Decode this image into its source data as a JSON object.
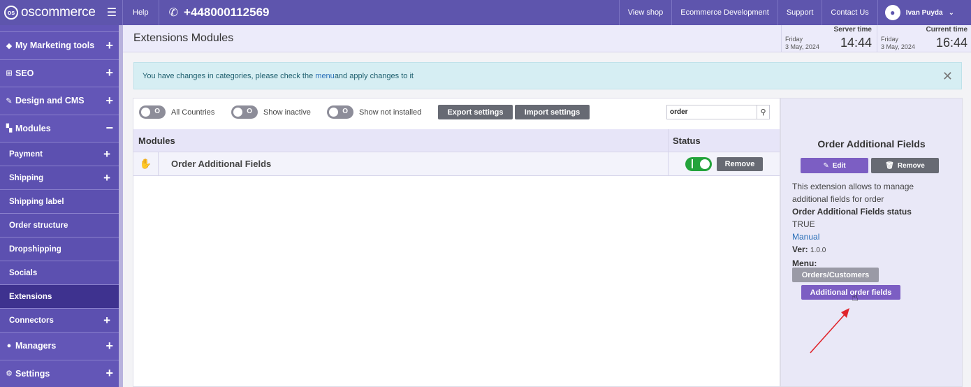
{
  "topbar": {
    "logo_text": "oscommerce",
    "help": "Help",
    "phone": "+448000112569",
    "links": [
      "View shop",
      "Ecommerce Development",
      "Support",
      "Contact Us"
    ],
    "user": "Ivan Puyda"
  },
  "sidebar": {
    "items": [
      {
        "label": "My Marketing tools",
        "icon": "tag-icon",
        "expand": "+"
      },
      {
        "label": "SEO",
        "icon": "sitemap-icon",
        "expand": "+"
      },
      {
        "label": "Design and CMS",
        "icon": "brush-icon",
        "expand": "+"
      },
      {
        "label": "Modules",
        "icon": "puzzle-icon",
        "expand": "−"
      }
    ],
    "subitems": [
      {
        "label": "Payment",
        "expand": "+"
      },
      {
        "label": "Shipping",
        "expand": "+"
      },
      {
        "label": "Shipping label",
        "expand": ""
      },
      {
        "label": "Order structure",
        "expand": ""
      },
      {
        "label": "Dropshipping",
        "expand": ""
      },
      {
        "label": "Socials",
        "expand": ""
      },
      {
        "label": "Extensions",
        "expand": ""
      },
      {
        "label": "Connectors",
        "expand": "+"
      }
    ],
    "bottom_items": [
      {
        "label": "Managers",
        "icon": "user-icon",
        "expand": "+"
      },
      {
        "label": "Settings",
        "icon": "gears-icon",
        "expand": "+"
      }
    ]
  },
  "header": {
    "title": "Extensions Modules",
    "server_time": {
      "label": "Server time",
      "day": "Friday",
      "date": "3 May, 2024",
      "time": "14:44"
    },
    "current_time": {
      "label": "Current time",
      "day": "Friday",
      "date": "3 May, 2024",
      "time": "16:44"
    }
  },
  "alert": {
    "text_before": "You have changes in categories, please check the ",
    "link": "menu",
    "text_after": " and apply changes to it"
  },
  "toolbar": {
    "toggle_countries": "All Countries",
    "toggle_inactive": "Show inactive",
    "toggle_not_installed": "Show not installed",
    "toggle_state": "O",
    "export": "Export settings",
    "import": "Import settings",
    "search_value": "order"
  },
  "table": {
    "col_modules": "Modules",
    "col_status": "Status",
    "rows": [
      {
        "name": "Order Additional Fields",
        "remove": "Remove",
        "status_on": true
      }
    ]
  },
  "info": {
    "title": "Order Additional Fields",
    "edit": "Edit",
    "remove": "Remove",
    "description": "This extension allows to manage additional fields for order",
    "status_label": "Order Additional Fields status",
    "status_value": "TRUE",
    "manual": "Manual",
    "ver_label": "Ver:",
    "ver_value": "1.0.0",
    "menu_label": "Menu:",
    "menu_btn1": "Orders/Customers",
    "menu_btn2": "Additional order fields"
  },
  "colors": {
    "brand": "#5e55ad",
    "accent_purple": "#7c5ec3",
    "status_green": "#23a33b",
    "alert_bg": "#d6eef3",
    "annotation_arrow": "#e0242b"
  }
}
